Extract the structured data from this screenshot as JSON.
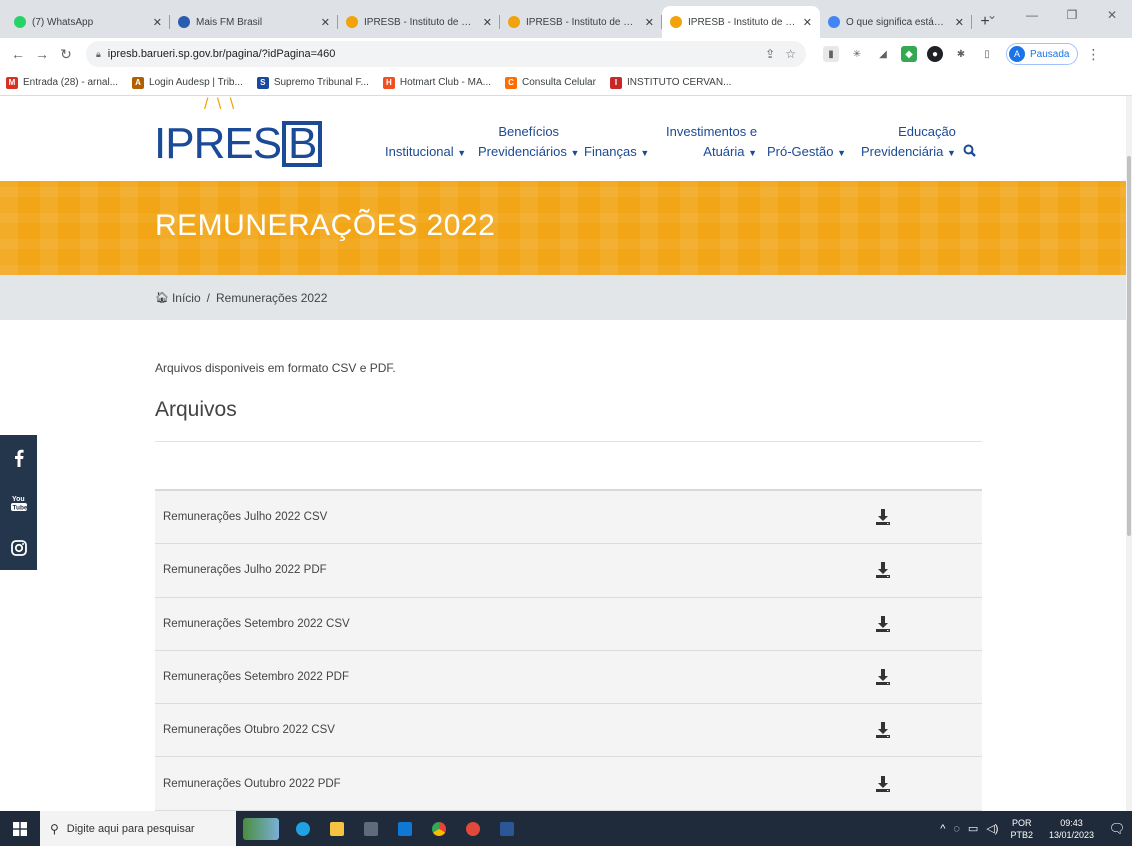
{
  "browser": {
    "tabs": [
      {
        "title": "(7) WhatsApp",
        "favicon_color": "#25d366",
        "active": false
      },
      {
        "title": "Mais FM Brasil",
        "favicon_color": "#2a5db0",
        "active": false
      },
      {
        "title": "IPRESB - Instituto de Previdê",
        "favicon_color": "#f0a30a",
        "active": false
      },
      {
        "title": "IPRESB - Instituto de Previdê",
        "favicon_color": "#f0a30a",
        "active": false
      },
      {
        "title": "IPRESB - Instituto de Previdê",
        "favicon_color": "#f0a30a",
        "active": true
      },
      {
        "title": "O que significa estágio? - Glo",
        "favicon_color": "#4285f4",
        "active": false
      }
    ],
    "url": "ipresb.barueri.sp.gov.br/pagina/?idPagina=460",
    "profile_initial": "A",
    "profile_label": "Pausada",
    "bookmarks": [
      {
        "label": "Entrada (28) - arnal...",
        "color": "#d93025",
        "glyph": "M"
      },
      {
        "label": "Login Audesp | Trib...",
        "color": "#b06000",
        "glyph": "A"
      },
      {
        "label": "Supremo Tribunal F...",
        "color": "#1a47a0",
        "glyph": "S"
      },
      {
        "label": "Hotmart Club - MA...",
        "color": "#f04e23",
        "glyph": "H"
      },
      {
        "label": "Consulta Celular",
        "color": "#ff6d00",
        "glyph": "C"
      },
      {
        "label": "INSTITUTO CERVAN...",
        "color": "#c62828",
        "glyph": "I"
      }
    ]
  },
  "site": {
    "logo_text": "IPRES",
    "logo_box_letter": "B",
    "nav": {
      "institucional": "Institucional",
      "beneficios_top": "Benefícios",
      "beneficios_bottom": "Previdenciários",
      "financas": "Finanças",
      "investimentos_top": "Investimentos e",
      "investimentos_bottom": "Atuária",
      "pro_gestao": "Pró-Gestão",
      "educacao_top": "Educação",
      "educacao_bottom": "Previdenciária"
    },
    "colors": {
      "brand_blue": "#1b4a96",
      "hero_orange": "#f2a617",
      "social_bg": "#24364b"
    }
  },
  "page": {
    "title": "REMUNERAÇÕES 2022",
    "breadcrumb_home": "Início",
    "breadcrumb_sep": "/",
    "breadcrumb_current": "Remunerações 2022",
    "intro": "Arquivos disponiveis em formato CSV e PDF.",
    "section_title": "Arquivos",
    "files": [
      "Remunerações Julho 2022 CSV",
      "Remunerações Julho 2022 PDF",
      "Remunerações Setembro 2022 CSV",
      "Remunerações Setembro 2022 PDF",
      "Remunerações Otubro 2022 CSV",
      "Remunerações Outubro 2022 PDF"
    ]
  },
  "taskbar": {
    "search_placeholder": "Digite aqui para pesquisar",
    "lang_top": "POR",
    "lang_bottom": "PTB2",
    "time": "09:43",
    "date": "13/01/2023"
  }
}
